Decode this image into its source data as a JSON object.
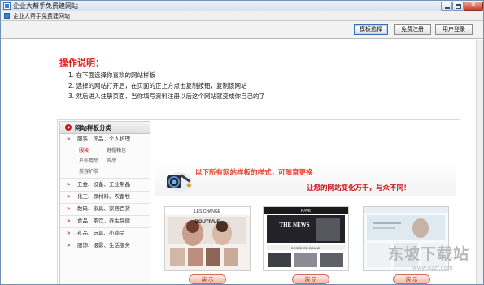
{
  "window": {
    "title": "企业大帮手免费建网站"
  },
  "menubar": {
    "label": "企业大帮手免费建网站"
  },
  "toolbar": {
    "template_select": "模板选择",
    "free_register": "免费注册",
    "user_login": "用户登录"
  },
  "instructions": {
    "title": "操作说明：",
    "steps": [
      "1. 在下面选择你喜欢的网站样板",
      "2. 选择的网站打开后，在页面的正上方点击复制按钮，复制该网站",
      "3. 然后进入注册页面，当你填写资料注册以后这个网站就变成你自己的了"
    ]
  },
  "sidebar": {
    "header": "网站样板分类",
    "categories": [
      {
        "arrow": "»",
        "label": "服装、饰品、个人护理",
        "subs": [
          "服装",
          "鞋帽箱包",
          "户外用品",
          "饰品",
          "美容护肤"
        ]
      },
      {
        "arrow": "»",
        "label": "五金、设备、工业制品"
      },
      {
        "arrow": "»",
        "label": "化工、原材料、农畜牧"
      },
      {
        "arrow": "»",
        "label": "数码、家具、家居百货"
      },
      {
        "arrow": "»",
        "label": "食品、茶饮、养生保健"
      },
      {
        "arrow": "»",
        "label": "礼品、玩具、小商品"
      },
      {
        "arrow": "»",
        "label": "服饰、摄影、生活服务"
      }
    ],
    "selected_sub": "服装"
  },
  "banner": {
    "line1": "以下所有网站样板的样式，可随意更换",
    "line2": "让您的网站变化万千，与众不同！"
  },
  "templates": [
    {
      "brand": "LES CHANGE",
      "heading": "BOUTIVUE",
      "demo": "演 示"
    },
    {
      "brand": "RAVE",
      "heading": "THE NEWS",
      "sub": "DESIGNER BRAND",
      "demo": "演 示"
    },
    {
      "brand": "",
      "heading": "",
      "demo": "演 示"
    }
  ],
  "watermark": {
    "text": "东坡下载站",
    "url": "www.uzzf.com"
  },
  "colors": {
    "accent_red": "#e0211c",
    "titlebar": "#d6e2f1"
  }
}
